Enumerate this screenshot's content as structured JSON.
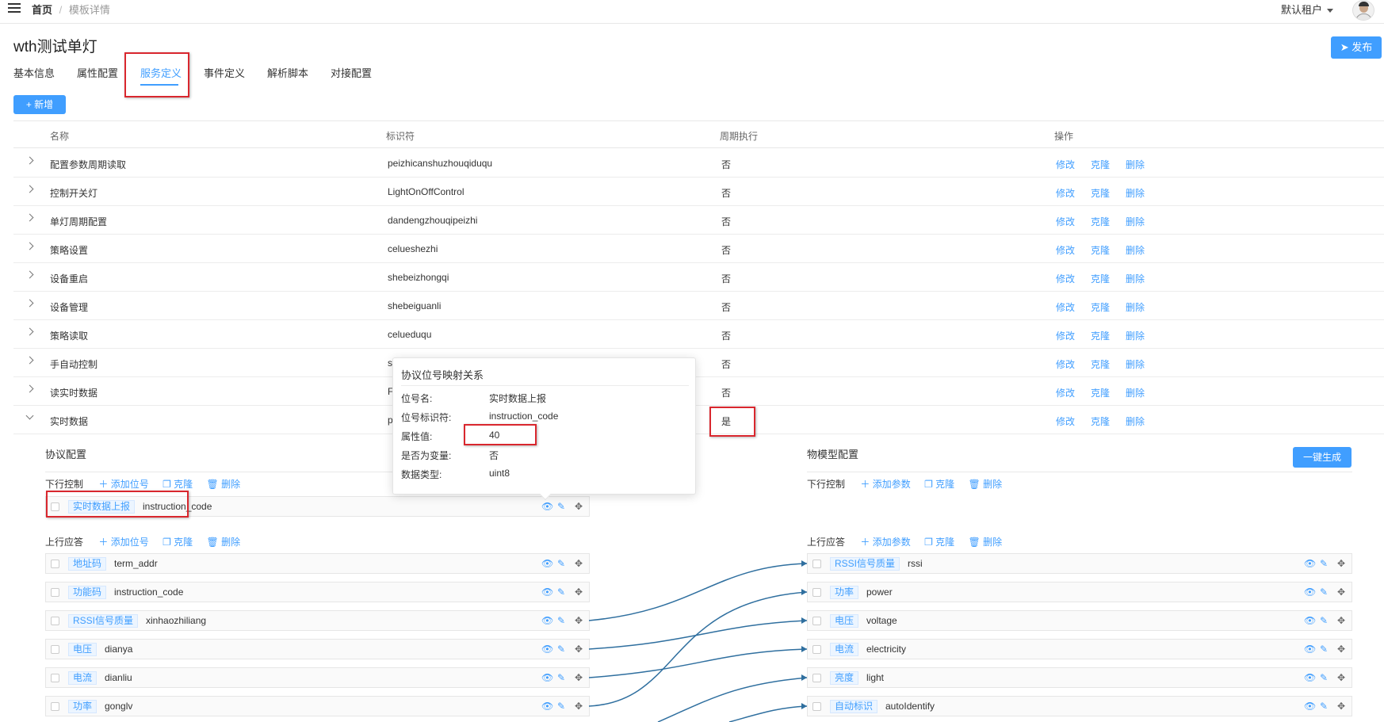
{
  "header": {
    "breadcrumb_home": "首页",
    "breadcrumb_sep": "/",
    "breadcrumb_current": "模板详情",
    "tenant": "默认租户"
  },
  "page": {
    "title": "wth测试单灯",
    "publish": "发布",
    "tabs": [
      "基本信息",
      "属性配置",
      "服务定义",
      "事件定义",
      "解析脚本",
      "对接配置"
    ],
    "active_tab": 2,
    "add": "+ 新增"
  },
  "table": {
    "columns": [
      "名称",
      "标识符",
      "周期执行",
      "操作"
    ],
    "ops": [
      "修改",
      "克隆",
      "删除"
    ],
    "rows": [
      {
        "name": "配置参数周期读取",
        "id": "peizhicanshuzhouqiduqu",
        "periodic": "否"
      },
      {
        "name": "控制开关灯",
        "id": "LightOnOffControl",
        "periodic": "否"
      },
      {
        "name": "单灯周期配置",
        "id": "dandengzhouqipeizhi",
        "periodic": "否"
      },
      {
        "name": "策略设置",
        "id": "celueshezhi",
        "periodic": "否"
      },
      {
        "name": "设备重启",
        "id": "shebeizhongqi",
        "periodic": "否"
      },
      {
        "name": "设备管理",
        "id": "shebeiguanli",
        "periodic": "否"
      },
      {
        "name": "策略读取",
        "id": "celueduqu",
        "periodic": "否"
      },
      {
        "name": "手自动控制",
        "id": "s",
        "periodic": "否"
      },
      {
        "name": "读实时数据",
        "id": "F",
        "periodic": "否"
      },
      {
        "name": "实时数据",
        "id": "p",
        "periodic": "是"
      }
    ]
  },
  "expanded": {
    "protocol_title": "协议配置",
    "model_title": "物模型配置",
    "generate": "一键生成",
    "down_label": "下行控制",
    "up_label": "上行应答",
    "add_bit": "添加位号",
    "add_param": "添加参数",
    "clone": "克隆",
    "delete": "删除",
    "protocol_down": [
      {
        "tag": "实时数据上报",
        "code": "instruction_code"
      }
    ],
    "protocol_up": [
      {
        "tag": "地址码",
        "code": "term_addr"
      },
      {
        "tag": "功能码",
        "code": "instruction_code"
      },
      {
        "tag": "RSSI信号质量",
        "code": "xinhaozhiliang"
      },
      {
        "tag": "电压",
        "code": "dianya"
      },
      {
        "tag": "电流",
        "code": "dianliu"
      },
      {
        "tag": "功率",
        "code": "gonglv"
      }
    ],
    "model_up": [
      {
        "tag": "RSSI信号质量",
        "code": "rssi"
      },
      {
        "tag": "功率",
        "code": "power"
      },
      {
        "tag": "电压",
        "code": "voltage"
      },
      {
        "tag": "电流",
        "code": "electricity"
      },
      {
        "tag": "亮度",
        "code": "light"
      },
      {
        "tag": "自动标识",
        "code": "autoIdentify"
      }
    ]
  },
  "popover": {
    "title": "协议位号映射关系",
    "fields": [
      {
        "k": "位号名:",
        "v": "实时数据上报"
      },
      {
        "k": "位号标识符:",
        "v": "instruction_code"
      },
      {
        "k": "属性值:",
        "v": "40"
      },
      {
        "k": "是否为变量:",
        "v": "否"
      },
      {
        "k": "数据类型:",
        "v": "uint8"
      }
    ]
  },
  "colors": {
    "accent": "#409eff",
    "highlight": "#d9272e",
    "link_line": "#2f6f9f"
  }
}
